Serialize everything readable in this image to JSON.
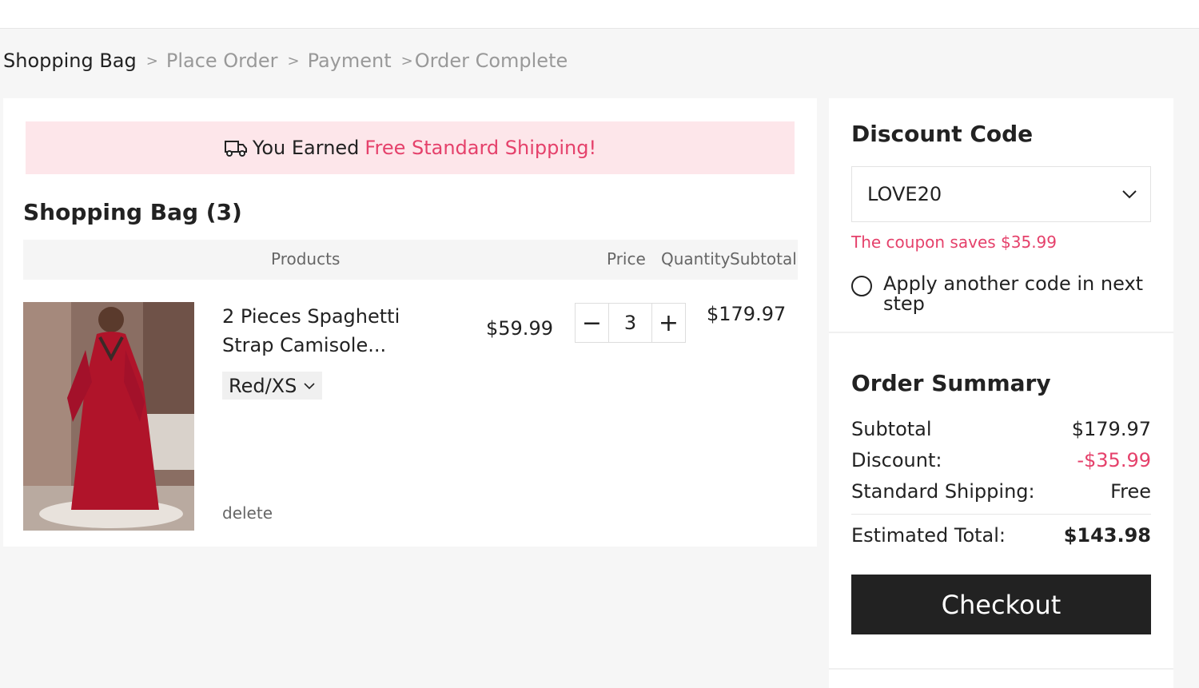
{
  "breadcrumb": {
    "steps": [
      "Shopping Bag",
      "Place Order",
      "Payment",
      "Order Complete"
    ],
    "separator": ">"
  },
  "shipping_banner": {
    "prefix": "You Earned",
    "highlight": "Free Standard Shipping!",
    "icon": "truck-icon",
    "highlight_color": "#e5416b"
  },
  "bag": {
    "title": "Shopping Bag (3)",
    "columns": {
      "products": "Products",
      "price": "Price",
      "quantity": "Quantity",
      "subtotal": "Subtotal"
    },
    "items": [
      {
        "name": "2 Pieces Spaghetti Strap Camisole...",
        "variant": "Red/XS",
        "price": "$59.99",
        "quantity": "3",
        "minus": "−",
        "plus": "+",
        "subtotal": "$179.97",
        "delete": "delete"
      }
    ]
  },
  "discount": {
    "title": "Discount Code",
    "selected_code": "LOVE20",
    "message": "The coupon saves $35.99",
    "option_label": "Apply another code in next step"
  },
  "order_summary": {
    "title": "Order Summary",
    "subtotal_label": "Subtotal",
    "subtotal_value": "$179.97",
    "discount_label": "Discount:",
    "discount_value": "-$35.99",
    "shipping_label": "Standard Shipping:",
    "shipping_value": "Free",
    "total_label": "Estimated Total:",
    "total_value": "$143.98"
  },
  "checkout_label": "Checkout",
  "colors": {
    "accent_pink": "#e5416b",
    "banner_bg": "#fde6ea",
    "button_dark": "#222222"
  }
}
